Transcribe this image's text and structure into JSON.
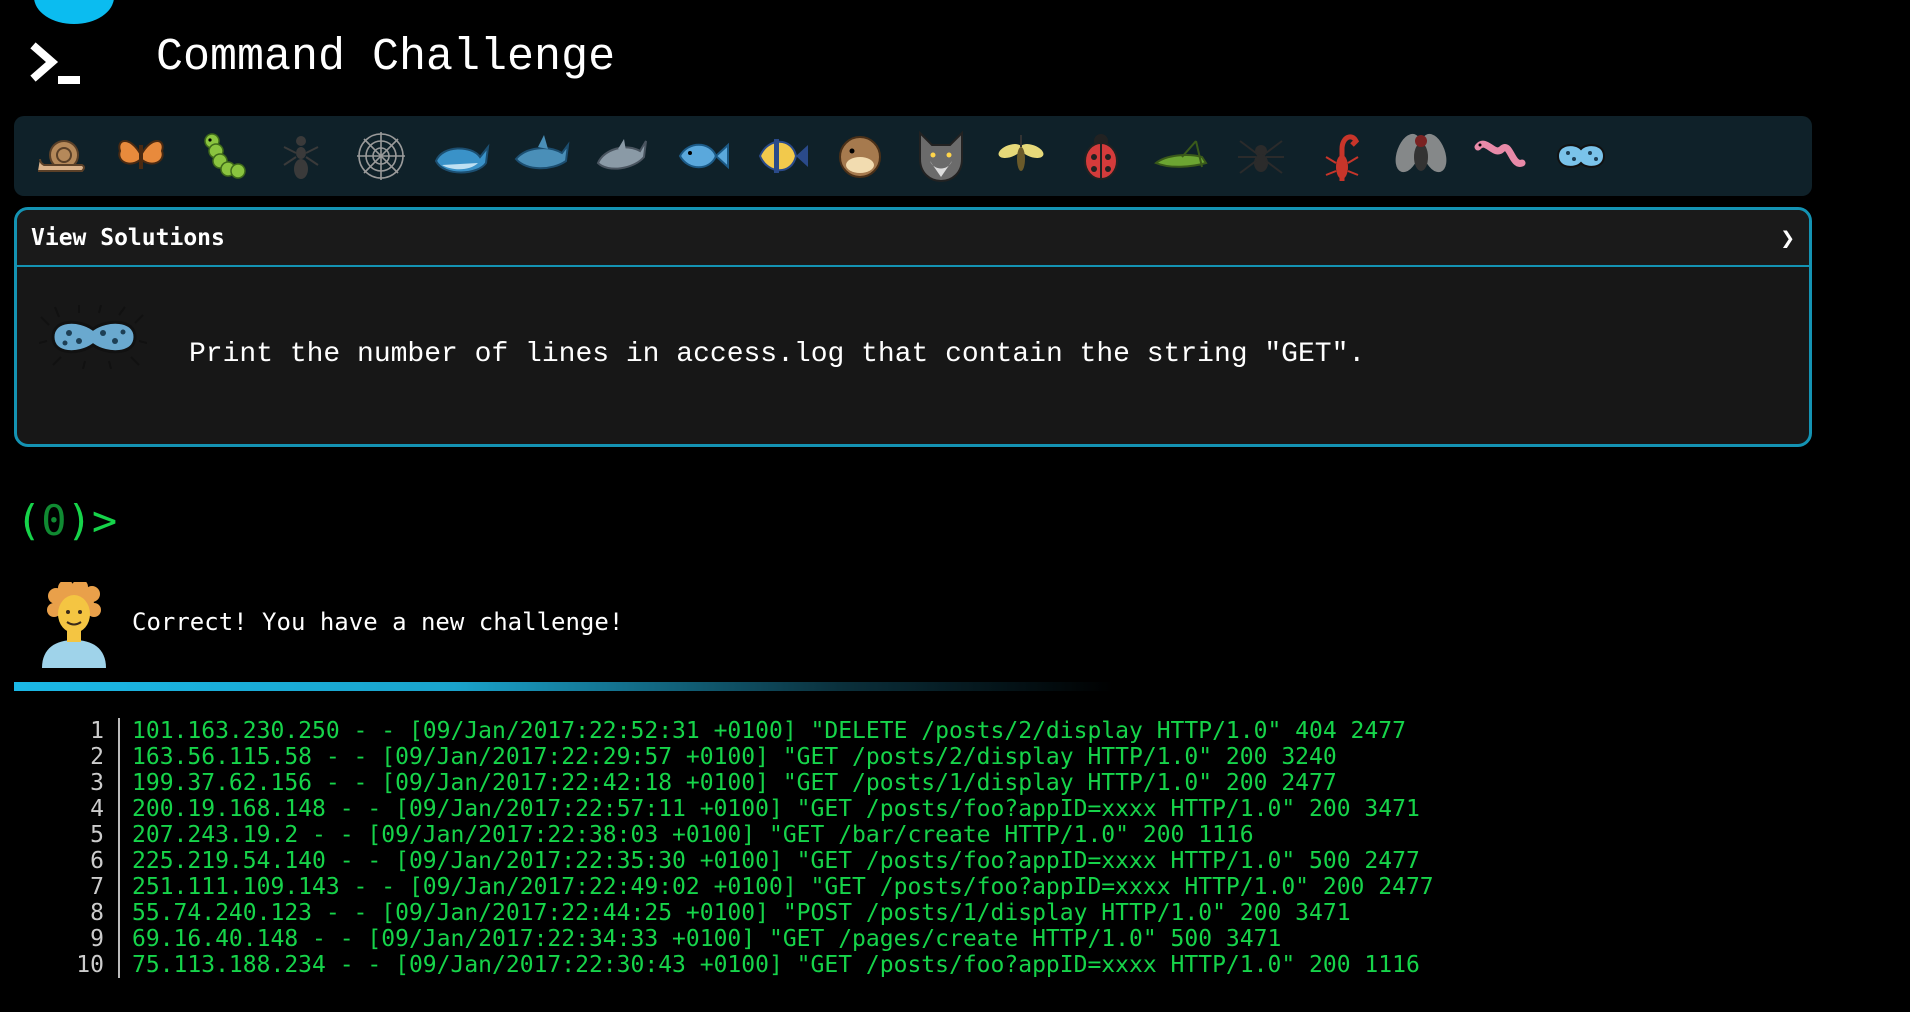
{
  "header": {
    "title": "Command Challenge",
    "logo_icon": "terminal-prompt-icon"
  },
  "animals": [
    {
      "name": "snail",
      "icon": "snail-icon",
      "color": "#b5895a"
    },
    {
      "name": "butterfly",
      "icon": "butterfly-icon",
      "color": "#e88a3c"
    },
    {
      "name": "caterpillar",
      "icon": "caterpillar-icon",
      "color": "#8ac43f"
    },
    {
      "name": "ant",
      "icon": "ant-icon",
      "color": "#3a3a3a"
    },
    {
      "name": "spider-web",
      "icon": "spider-web-icon",
      "color": "#9a9a9a"
    },
    {
      "name": "whale",
      "icon": "whale-icon",
      "color": "#3a92c8"
    },
    {
      "name": "shark",
      "icon": "shark-icon",
      "color": "#4a8fb8"
    },
    {
      "name": "dolphin",
      "icon": "dolphin-icon",
      "color": "#8a9aa6"
    },
    {
      "name": "fish",
      "icon": "fish-icon",
      "color": "#5aa8dc"
    },
    {
      "name": "tropical-fish",
      "icon": "tropical-fish-icon",
      "color": "#f2c94c"
    },
    {
      "name": "blowfish",
      "icon": "blowfish-icon",
      "color": "#a67a4e"
    },
    {
      "name": "wolf",
      "icon": "wolf-icon",
      "color": "#6b6b6b"
    },
    {
      "name": "mosquito",
      "icon": "mosquito-icon",
      "color": "#e6d97a"
    },
    {
      "name": "ladybug",
      "icon": "ladybug-icon",
      "color": "#d43b3b"
    },
    {
      "name": "cricket",
      "icon": "cricket-icon",
      "color": "#6ca532"
    },
    {
      "name": "spider",
      "icon": "spider-icon",
      "color": "#2b2b2b"
    },
    {
      "name": "scorpion",
      "icon": "scorpion-icon",
      "color": "#c8352a"
    },
    {
      "name": "fly",
      "icon": "fly-icon",
      "color": "#9a9a9a"
    },
    {
      "name": "worm",
      "icon": "worm-icon",
      "color": "#e88aa8"
    },
    {
      "name": "microbe",
      "icon": "microbe-icon",
      "color": "#7ac3ea"
    }
  ],
  "panel": {
    "view_solutions_label": "View Solutions",
    "chevron": "❯",
    "challenge_text": "Print the number of lines in access.log that contain the string \"GET\".",
    "challenge_icon": "microbe-icon"
  },
  "prompt": {
    "open": "(",
    "count": "0",
    "close": ")>"
  },
  "result": {
    "message": "Correct! You have a new challenge!",
    "avatar_icon": "person-curly-hair-icon"
  },
  "file_lines": [
    {
      "n": "1",
      "text": "101.163.230.250 - - [09/Jan/2017:22:52:31 +0100] \"DELETE /posts/2/display HTTP/1.0\" 404 2477"
    },
    {
      "n": "2",
      "text": "163.56.115.58 - - [09/Jan/2017:22:29:57 +0100] \"GET /posts/2/display HTTP/1.0\" 200 3240"
    },
    {
      "n": "3",
      "text": "199.37.62.156 - - [09/Jan/2017:22:42:18 +0100] \"GET /posts/1/display HTTP/1.0\" 200 2477"
    },
    {
      "n": "4",
      "text": "200.19.168.148 - - [09/Jan/2017:22:57:11 +0100] \"GET /posts/foo?appID=xxxx HTTP/1.0\" 200 3471"
    },
    {
      "n": "5",
      "text": "207.243.19.2 - - [09/Jan/2017:22:38:03 +0100] \"GET /bar/create HTTP/1.0\" 200 1116"
    },
    {
      "n": "6",
      "text": "225.219.54.140 - - [09/Jan/2017:22:35:30 +0100] \"GET /posts/foo?appID=xxxx HTTP/1.0\" 500 2477"
    },
    {
      "n": "7",
      "text": "251.111.109.143 - - [09/Jan/2017:22:49:02 +0100] \"GET /posts/foo?appID=xxxx HTTP/1.0\" 200 2477"
    },
    {
      "n": "8",
      "text": "55.74.240.123 - - [09/Jan/2017:22:44:25 +0100] \"POST /posts/1/display HTTP/1.0\" 200 3471"
    },
    {
      "n": "9",
      "text": "69.16.40.148 - - [09/Jan/2017:22:34:33 +0100] \"GET /pages/create HTTP/1.0\" 500 3471"
    },
    {
      "n": "10",
      "text": "75.113.188.234 - - [09/Jan/2017:22:30:43 +0100] \"GET /posts/foo?appID=xxxx HTTP/1.0\" 200 1116"
    }
  ],
  "colors": {
    "accent": "#1493b3",
    "terminal_green": "#16d44a",
    "background": "#000000",
    "panel": "#171717"
  }
}
